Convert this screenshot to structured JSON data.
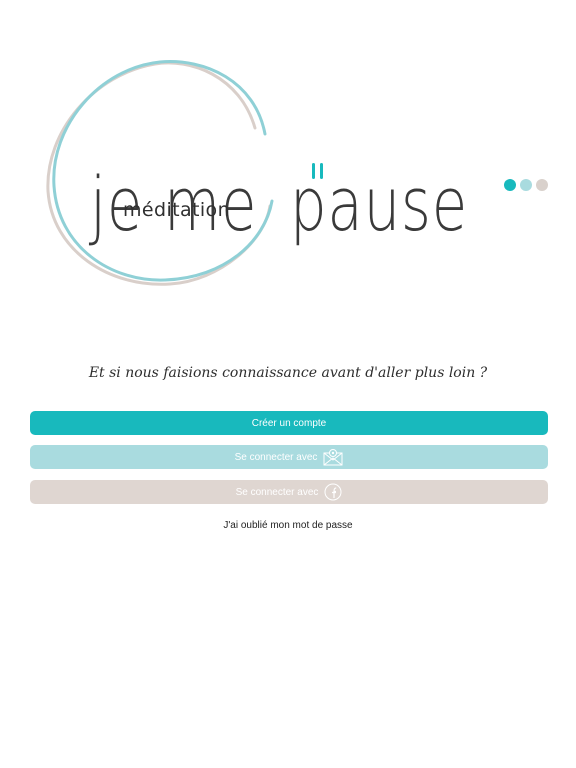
{
  "colors": {
    "teal": "#18b9bd",
    "light_teal": "#a9dbdf",
    "beige": "#dfd6d1",
    "text_dark": "#222222"
  },
  "logo": {
    "word_1": "je",
    "word_2": "me",
    "word_3": "pause",
    "subtitle": "méditation",
    "pause_symbol_icon": "pause-icon",
    "dots": [
      "teal",
      "light_teal",
      "beige"
    ]
  },
  "tagline": "Et si nous faisions connaissance avant d'aller plus loin ?",
  "buttons": {
    "create_account": "Créer un compte",
    "connect_mail": "Se connecter avec",
    "connect_mail_icon": "envelope-icon",
    "connect_facebook": "Se connecter avec",
    "connect_facebook_icon": "facebook-icon"
  },
  "forgot_password": "J'ai oublié mon mot de passe"
}
